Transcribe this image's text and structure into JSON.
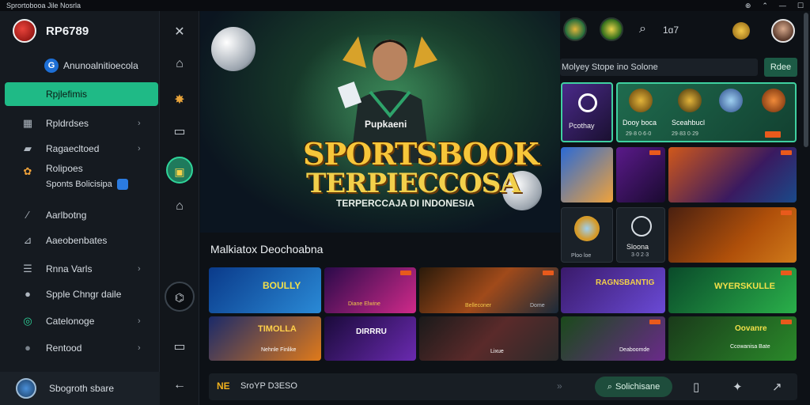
{
  "window": {
    "title": "Sprortobooa Jile Nosrla",
    "controls": [
      "⊕",
      "⌃",
      "—",
      "☐"
    ]
  },
  "sidebar": {
    "brand": "RP6789",
    "sub_account": "Anunoalnitioecola",
    "active_item": "Rpjlefimis",
    "items": [
      {
        "icon": "grid-icon",
        "glyph": "▦",
        "label": "Rpldrdses",
        "chevron": "›"
      },
      {
        "icon": "folder-icon",
        "glyph": "▰",
        "label": "Ragaecltoed",
        "chevron": "›"
      },
      {
        "icon": "badge-icon",
        "glyph": "✿",
        "label": "Rolipoes",
        "label2": "Sponts Bolicisipa"
      },
      {
        "icon": "wrench-icon",
        "glyph": "⁄",
        "label": "Aarlbotng"
      },
      {
        "icon": "chart-icon",
        "glyph": "⊿",
        "label": "Aaeobenbates"
      },
      {
        "icon": "list-icon",
        "glyph": "☰",
        "label": "Rnna Varls",
        "chevron": "›"
      },
      {
        "icon": "user-icon",
        "glyph": "●",
        "label": "Spple Chngr daile"
      },
      {
        "icon": "target-icon",
        "glyph": "◎",
        "label": "Catelonoge",
        "chevron": "›"
      },
      {
        "icon": "dot-icon",
        "glyph": "●",
        "label": "Rentood",
        "chevron": "›"
      }
    ],
    "footer_label": "Sbogroth sbare"
  },
  "rail": [
    {
      "name": "close-icon",
      "glyph": "✕"
    },
    {
      "name": "home-icon",
      "glyph": "⌂"
    },
    {
      "name": "gear-icon",
      "glyph": "✸"
    },
    {
      "name": "bag-icon",
      "glyph": "▭"
    },
    {
      "name": "trophy-icon",
      "glyph": "▣"
    },
    {
      "name": "ticket-icon",
      "glyph": "⌂"
    },
    {
      "name": "expand-icon",
      "glyph": "⌬"
    },
    {
      "name": "panel-icon",
      "glyph": "▭"
    },
    {
      "name": "back-icon",
      "glyph": "←"
    }
  ],
  "hero": {
    "player_name": "Pupkaeni",
    "title_line1": "SPORTSBOOK",
    "title_line2": "TERPIECCOSA",
    "subtitle": "TERPERCCAJA DI INDONESIA"
  },
  "top": {
    "search_value": "1ɑ7",
    "search_label": "Molyey Stope ino Solone",
    "search_button": "Rdee"
  },
  "featured": [
    {
      "label": "Pcothay",
      "sub": ""
    },
    {
      "label": "Dooy boca",
      "sub": "29·8 0·6·0"
    },
    {
      "label": "Sceahbucl",
      "sub": "29·83 0·29"
    }
  ],
  "side_cards": [
    {
      "label": "Sloona",
      "sub": "3·0 2·3"
    },
    {
      "label": "Fielo boe",
      "sub": ""
    }
  ],
  "section_title": "Malkiatox Deochoabna",
  "games_row1": [
    {
      "title": "BOULLY",
      "caption": ""
    },
    {
      "title": "",
      "caption": "Diane Elwine"
    },
    {
      "title": "",
      "caption": "Belleconer"
    },
    {
      "title": "",
      "caption": "Dome"
    },
    {
      "title": "RAGNSBANTIG",
      "caption": ""
    },
    {
      "title": "WYERSKULLE",
      "caption": ""
    }
  ],
  "games_row2": [
    {
      "title": "TIMOLLA",
      "caption": "Nehnle Finlike"
    },
    {
      "title": "DIRRRU",
      "caption": ""
    },
    {
      "title": "",
      "caption": "Lixue"
    },
    {
      "title": "",
      "caption": ""
    },
    {
      "title": "",
      "caption": "Deaboomde"
    },
    {
      "title": "Oovanre",
      "caption": "Ccowanisa Bate"
    }
  ],
  "bottom": {
    "logo": "NE",
    "text": "SroYP D3ESO",
    "arrows": "»",
    "pill": "Solichisane"
  },
  "colors": {
    "accent": "#1fba86",
    "gold": "#f7c63a",
    "bg": "#0d1116"
  }
}
